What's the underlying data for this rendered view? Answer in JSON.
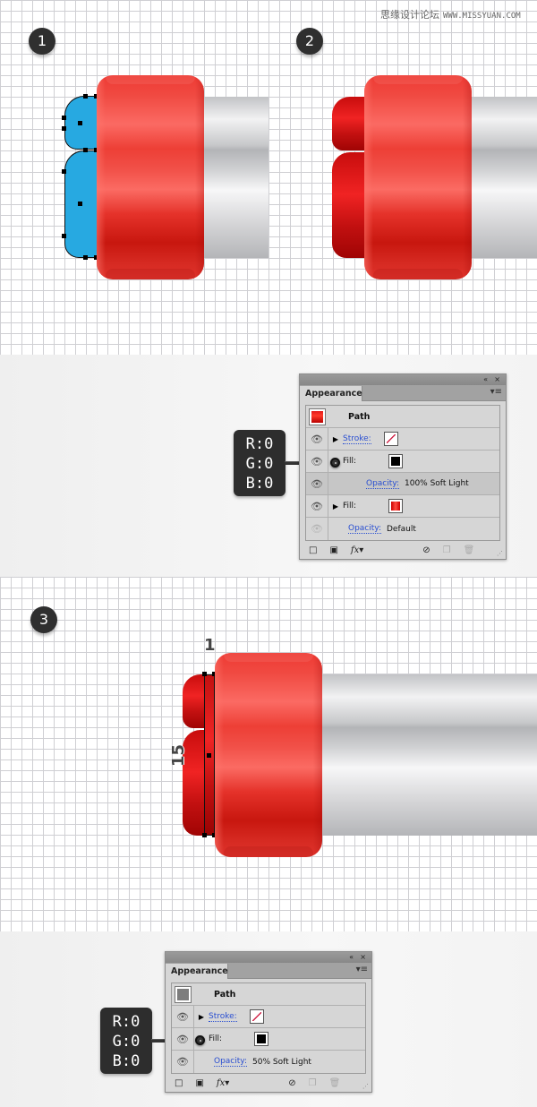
{
  "watermark": {
    "site_name": "思缘设计论坛",
    "url": "WWW.MISSYUAN.COM"
  },
  "steps": [
    {
      "number": "1",
      "description": "blue-selected-lobes"
    },
    {
      "number": "2",
      "description": "red-filled-lobes"
    },
    {
      "number": "3",
      "description": "thin-rectangle-added"
    }
  ],
  "dimensions": {
    "width_label": "1",
    "height_label": "15"
  },
  "colors": {
    "cap_red": "#ee3a33",
    "lobe_blue": "#27a9e1",
    "tube_silver": "#c7c8ca",
    "panel_bg": "#d6d6d6",
    "link_blue": "#2a4fd1",
    "callout_bg": "#2d2d2d"
  },
  "callout_1": {
    "r": "R:0",
    "g": "G:0",
    "b": "B:0"
  },
  "callout_2": {
    "r": "R:0",
    "g": "G:0",
    "b": "B:0"
  },
  "panel_1": {
    "title": "Appearance",
    "collapse_icon": "«",
    "close_icon": "×",
    "menu_icon": "▾≡",
    "object_label": "Path",
    "rows": [
      {
        "type": "stroke",
        "label": "Stroke:",
        "swatch": "none"
      },
      {
        "type": "fill",
        "label": "Fill:",
        "swatch": "#000000"
      },
      {
        "type": "opacity",
        "label": "Opacity:",
        "value": "100% Soft Light"
      },
      {
        "type": "fill",
        "label": "Fill:",
        "swatch": "red-gradient"
      },
      {
        "type": "opacity",
        "label": "Opacity:",
        "value": "Default"
      }
    ],
    "footer": {
      "fx_label": "fx"
    }
  },
  "panel_2": {
    "title": "Appearance",
    "collapse_icon": "«",
    "close_icon": "×",
    "menu_icon": "▾≡",
    "object_label": "Path",
    "rows": [
      {
        "type": "stroke",
        "label": "Stroke:",
        "swatch": "none"
      },
      {
        "type": "fill",
        "label": "Fill:",
        "swatch": "#000000"
      },
      {
        "type": "opacity",
        "label": "Opacity:",
        "value": "50% Soft Light"
      }
    ],
    "footer": {
      "fx_label": "fx"
    }
  }
}
